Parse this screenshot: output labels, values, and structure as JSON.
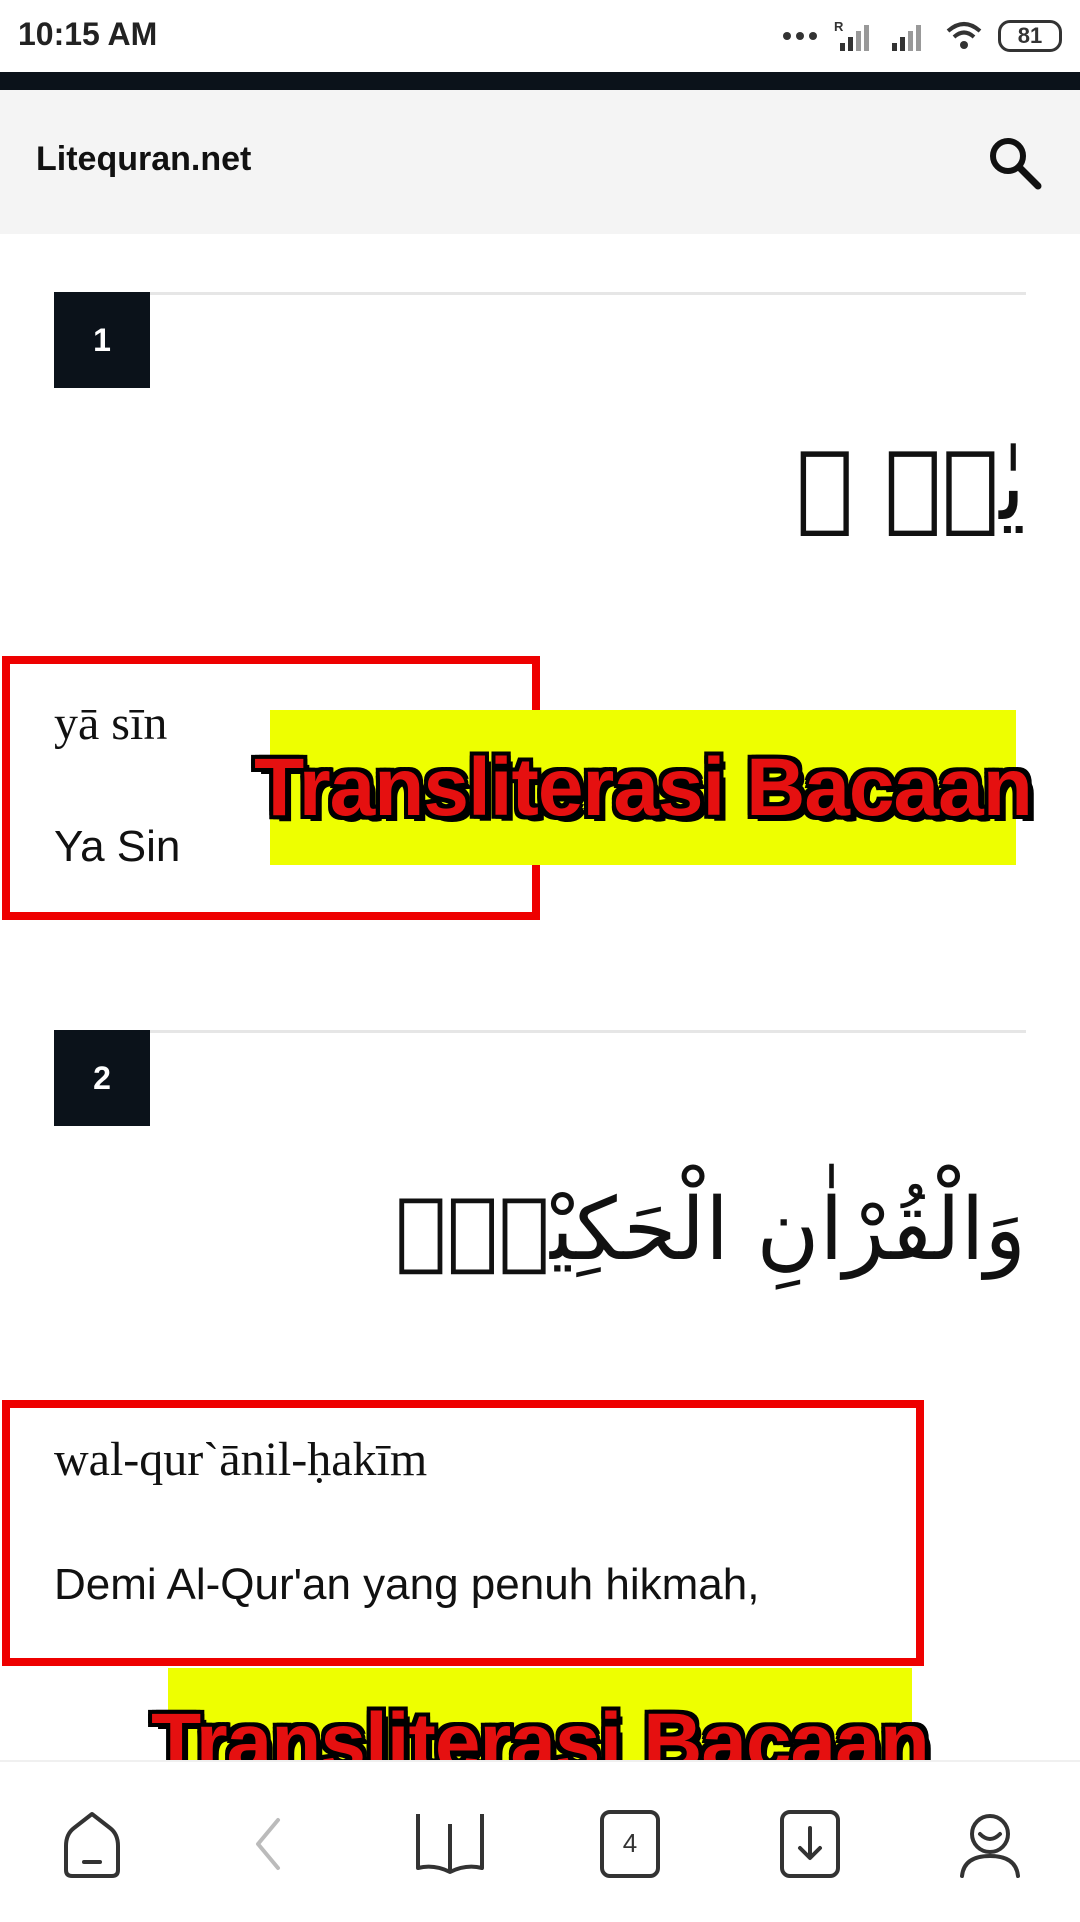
{
  "status_bar": {
    "time": "10:15 AM",
    "battery": "81",
    "icons": [
      "dots-icon",
      "signal-roaming-icon",
      "signal-icon",
      "wifi-icon",
      "battery-icon"
    ]
  },
  "header": {
    "title": "Litequran.net",
    "search_icon": "search-icon"
  },
  "verses": [
    {
      "number": "1",
      "arabic": "يٰسۤ ۚ",
      "transliteration": "yā sīn",
      "translation": "Ya Sin"
    },
    {
      "number": "2",
      "arabic": "وَالْقُرْاٰنِ الْحَكِيْمِۙ",
      "transliteration": "wal-qur`ānil-ḥakīm",
      "translation": "Demi Al-Qur'an yang penuh hikmah,"
    }
  ],
  "overlays": {
    "label_1": "Transliterasi Bacaan",
    "label_2": "Transliterasi Bacaan"
  },
  "bottom_nav": {
    "tab_count": "4",
    "items": [
      "home-icon",
      "back-icon",
      "book-icon",
      "tabs-icon",
      "download-icon",
      "profile-icon"
    ]
  },
  "colors": {
    "highlight_box": "#ee0000",
    "banner_bg": "#eeff00",
    "banner_text": "#e51010",
    "verse_number_bg": "#0b121a"
  }
}
